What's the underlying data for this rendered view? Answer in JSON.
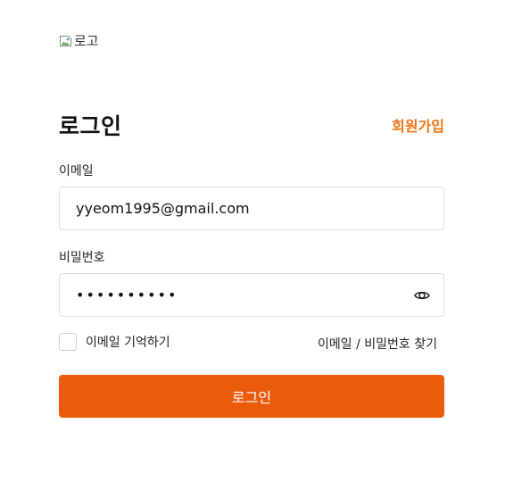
{
  "logo": {
    "alt_text": "로고",
    "icon": "broken-image-icon"
  },
  "header": {
    "title": "로그인",
    "signup_label": "회원가입",
    "signup_color": "#ee7418"
  },
  "form": {
    "email": {
      "label": "이메일",
      "value": "yyeom1995@gmail.com"
    },
    "password": {
      "label": "비밀번호",
      "value": "0123456789",
      "toggle_icon": "eye-icon"
    },
    "remember": {
      "label": "이메일 기억하기",
      "checked": false
    },
    "find_account_label": "이메일 / 비밀번호 찾기",
    "submit_label": "로그인",
    "submit_color": "#eb5b0c"
  }
}
